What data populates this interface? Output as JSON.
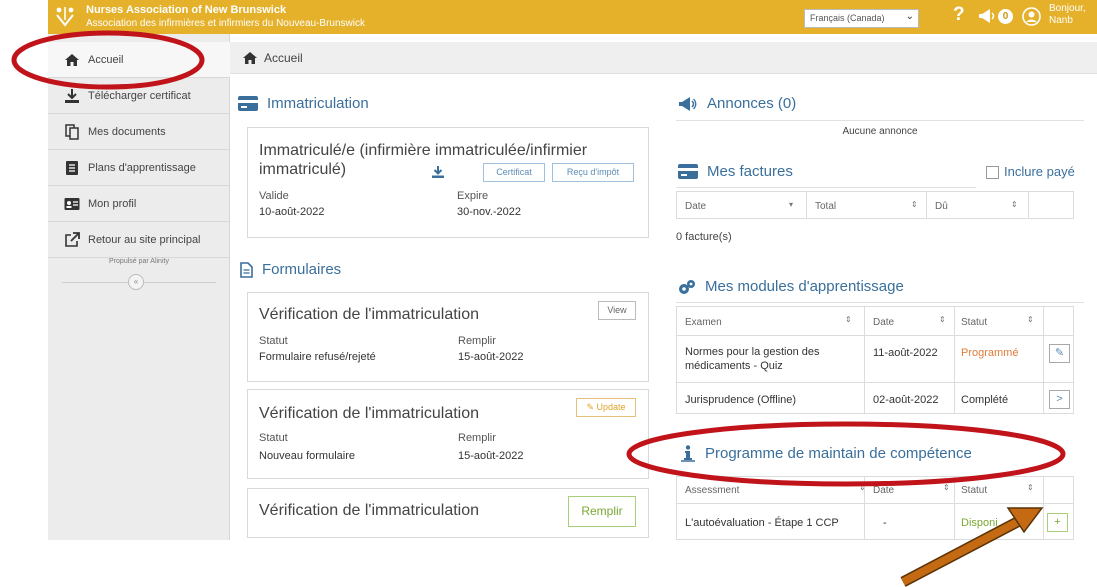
{
  "header": {
    "org_name_en": "Nurses Association of New Brunswick",
    "org_name_fr": "Association des infirmières et infirmiers du Nouveau-Brunswick",
    "language": "Français (Canada)",
    "help_glyph": "?",
    "announcements_count": "0",
    "greeting_line1": "Bonjour,",
    "greeting_line2": "Nanb"
  },
  "sidebar": {
    "items": [
      {
        "label": "Accueil",
        "icon": "home-icon"
      },
      {
        "label": "Télécharger certificat",
        "icon": "download-icon"
      },
      {
        "label": "Mes documents",
        "icon": "documents-icon"
      },
      {
        "label": "Plans d'apprentissage",
        "icon": "learning-plan-icon"
      },
      {
        "label": "Mon profil",
        "icon": "profile-card-icon"
      },
      {
        "label": "Retour au site principal",
        "icon": "external-link-icon"
      }
    ],
    "powered_by": "Propulsé par Alinity",
    "collapse_glyph": "«"
  },
  "breadcrumb": {
    "label": "Accueil"
  },
  "registration": {
    "section_title": "Immatriculation",
    "card_title_line1": "Immatriculé/e (infirmière immatriculée/infirmier",
    "card_title_line2": "immatriculé)",
    "certificate_button": "Certificat",
    "receipt_button": "Reçu d'impôt",
    "valid_label": "Valide",
    "valid_value": "10-août-2022",
    "expires_label": "Expire",
    "expires_value": "30-nov.-2022"
  },
  "forms": {
    "section_title": "Formulaires",
    "cards": [
      {
        "title": "Vérification de l'immatriculation",
        "action": "View",
        "status_label": "Statut",
        "status": "Formulaire refusé/rejeté",
        "fill_label": "Remplir",
        "fill_date": "15-août-2022"
      },
      {
        "title": "Vérification de l'immatriculation",
        "action": "Update",
        "status_label": "Statut",
        "status": "Nouveau formulaire",
        "fill_label": "Remplir",
        "fill_date": "15-août-2022"
      },
      {
        "title": "Vérification de l'immatriculation",
        "action": "Remplir"
      }
    ]
  },
  "announcements": {
    "section_title": "Annonces (0)",
    "empty_text": "Aucune annonce"
  },
  "invoices": {
    "section_title": "Mes factures",
    "include_paid_label": "Inclure payé",
    "columns": [
      "Date",
      "Total",
      "Dû"
    ],
    "count_text": "0 facture(s)"
  },
  "learning_modules": {
    "section_title": "Mes modules d'apprentissage",
    "columns": [
      "Examen",
      "Date",
      "Statut"
    ],
    "rows": [
      {
        "exam_line1": "Normes pour la gestion des",
        "exam_line2": "médicaments - Quiz",
        "date": "11-août-2022",
        "status": "Programmé",
        "status_color": "#e07b39",
        "action_icon": "pencil-icon"
      },
      {
        "exam_line1": "Jurisprudence (Offline)",
        "exam_line2": "",
        "date": "02-août-2022",
        "status": "Complété",
        "status_color": "#333333",
        "action_icon": "chevron-right-icon"
      }
    ]
  },
  "competence": {
    "section_title": "Programme de maintain de compétence",
    "columns": [
      "Assessment",
      "Date",
      "Statut"
    ],
    "rows": [
      {
        "assessment": "L'autoévaluation - Étape 1 CCP",
        "date": "-",
        "status": "Disponi",
        "status_color": "#7aa832",
        "action_icon": "plus-icon"
      }
    ]
  },
  "colors": {
    "brand_bar": "#e5b12b",
    "section_title": "#3a6f9c",
    "annotation_ellipse": "#c0141a",
    "annotation_arrow": "#c46a12"
  }
}
